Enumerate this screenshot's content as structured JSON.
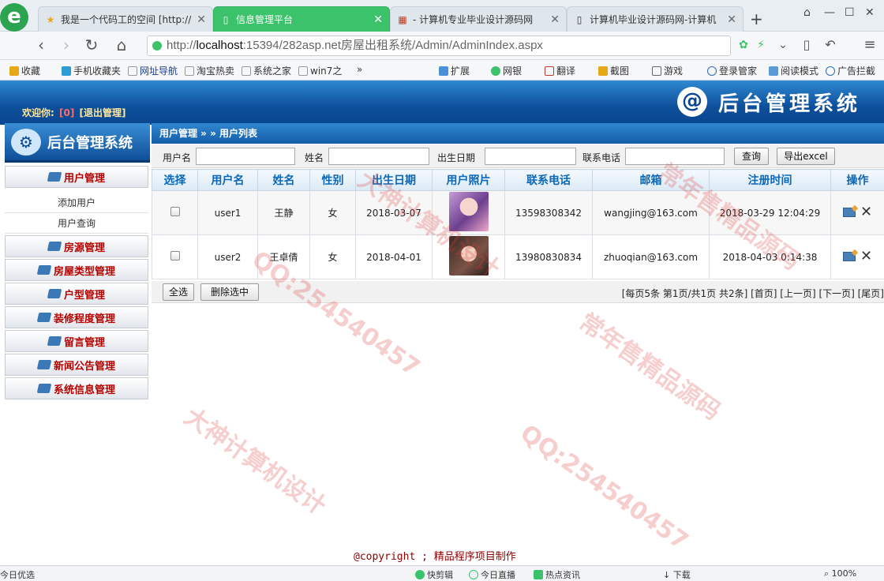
{
  "browser": {
    "tabs": [
      {
        "label": "我是一个代码工的空间 [http://",
        "icon": "star-icon",
        "active": false
      },
      {
        "label": "信息管理平台",
        "icon": "page-icon",
        "active": true
      },
      {
        "label": "- 计算机专业毕业设计源码网",
        "icon": "grid-icon",
        "active": false
      },
      {
        "label": "计算机毕业设计源码网-计算机",
        "icon": "page-icon",
        "active": false
      }
    ],
    "new_tab": "+",
    "url_prefix": "http://",
    "url_host": "localhost",
    "url_rest": ":15394/282asp.net房屋出租系统/Admin/AdminIndex.aspx",
    "bookmarks": [
      {
        "label": "收藏",
        "icon": "star-icon"
      },
      {
        "label": "手机收藏夹",
        "icon": "phone-icon"
      },
      {
        "label": "网址导航",
        "icon": "page-icon"
      },
      {
        "label": "淘宝热卖",
        "icon": "page-icon"
      },
      {
        "label": "系统之家",
        "icon": "page-icon"
      },
      {
        "label": "win7之",
        "icon": "page-icon"
      },
      {
        "label": "»",
        "icon": "chevron-icon"
      },
      {
        "label": "扩展",
        "icon": "grid-icon"
      },
      {
        "label": "网银",
        "icon": "bank-icon"
      },
      {
        "label": "翻译",
        "icon": "translate-icon"
      },
      {
        "label": "截图",
        "icon": "scissors-icon"
      },
      {
        "label": "游戏",
        "icon": "game-icon"
      },
      {
        "label": "登录管家",
        "icon": "search-icon"
      },
      {
        "label": "阅读模式",
        "icon": "book-icon"
      },
      {
        "label": "广告拦截",
        "icon": "block-icon"
      }
    ]
  },
  "admin": {
    "welcome": "欢迎你:",
    "user_tag": "[0]",
    "logout": "[退出管理]",
    "system_title": "后台管理系统",
    "sidebar_title": "后台管理系统",
    "menus": [
      {
        "label": "用户管理",
        "sub": [
          "添加用户",
          "用户查询"
        ]
      },
      {
        "label": "房源管理"
      },
      {
        "label": "房屋类型管理"
      },
      {
        "label": "户型管理"
      },
      {
        "label": "装修程度管理"
      },
      {
        "label": "留言管理"
      },
      {
        "label": "新闻公告管理"
      },
      {
        "label": "系统信息管理"
      }
    ],
    "breadcrumb": "用户管理 » » 用户列表",
    "search": {
      "username_label": "用户名",
      "name_label": "姓名",
      "birth_label": "出生日期",
      "phone_label": "联系电话",
      "username_value": "",
      "name_value": "",
      "birth_value": "",
      "phone_value": "",
      "query_button": "查询",
      "export_button": "导出excel"
    },
    "table": {
      "headers": [
        "选择",
        "用户名",
        "姓名",
        "性别",
        "出生日期",
        "用户照片",
        "联系电话",
        "邮箱",
        "注册时间",
        "操作"
      ],
      "rows": [
        {
          "username": "user1",
          "name": "王静",
          "gender": "女",
          "birth": "2018-03-07",
          "phone": "13598308342",
          "email": "wangjing@163.com",
          "registered": "2018-03-29 12:04:29"
        },
        {
          "username": "user2",
          "name": "王卓倩",
          "gender": "女",
          "birth": "2018-04-01",
          "phone": "13980830834",
          "email": "zhuoqian@163.com",
          "registered": "2018-04-03 0:14:38"
        }
      ]
    },
    "select_all": "全选",
    "delete_selected": "删除选中",
    "pager": "[每页5条 第1页/共1页 共2条] [首页] [上一页] [下一页] [尾页]",
    "copyright_code": "@copyright ;",
    "copyright_text": "精品程序项目制作"
  },
  "statusbar": {
    "left": "今日优选",
    "items": [
      "快剪辑",
      "今日直播",
      "热点资讯",
      "下载",
      "100%"
    ]
  },
  "watermarks": [
    "QQ:254540457",
    "大神计算机设计",
    "常年售精品源码",
    "QQ:254540457",
    "大神计算机设计",
    "常年售精品源码"
  ]
}
